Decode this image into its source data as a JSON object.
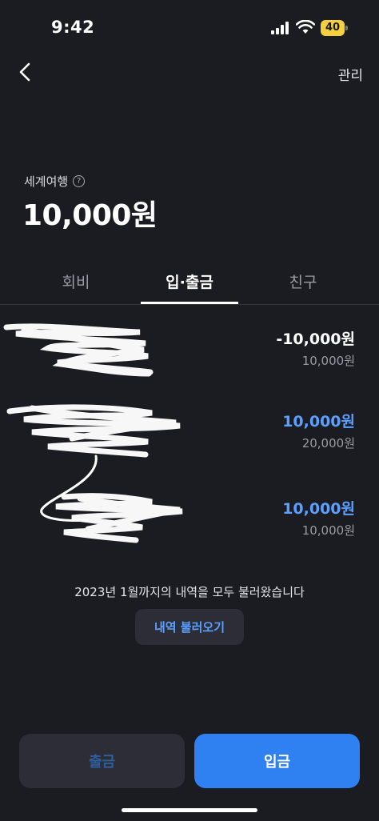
{
  "status_bar": {
    "time": "9:42",
    "battery": "40",
    "icons": [
      "signal-icon",
      "wifi-icon",
      "battery-icon"
    ]
  },
  "header": {
    "back_icon": "chevron-left-icon",
    "manage_label": "관리"
  },
  "account": {
    "name": "세계여행",
    "help_icon": "?",
    "balance": "10,000원"
  },
  "tabs": [
    {
      "label": "회비",
      "active": false
    },
    {
      "label": "입·출금",
      "active": true
    },
    {
      "label": "친구",
      "active": false
    }
  ],
  "transactions": [
    {
      "amount": "-10,000원",
      "balance": "10,000원",
      "type": "withdrawal"
    },
    {
      "amount": "10,000원",
      "balance": "20,000원",
      "type": "deposit"
    },
    {
      "amount": "10,000원",
      "balance": "10,000원",
      "type": "deposit"
    }
  ],
  "history": {
    "notice": "2023년 1월까지의 내역을 모두 불러왔습니다",
    "load_button": "내역 불러오기"
  },
  "actions": {
    "withdraw_label": "출금",
    "deposit_label": "입금"
  },
  "colors": {
    "background": "#1b1b22",
    "accent_blue": "#2f80f0",
    "deposit_amount": "#5ba0ff",
    "withdraw_amount": "#ffffff",
    "battery": "#f4d03f"
  }
}
